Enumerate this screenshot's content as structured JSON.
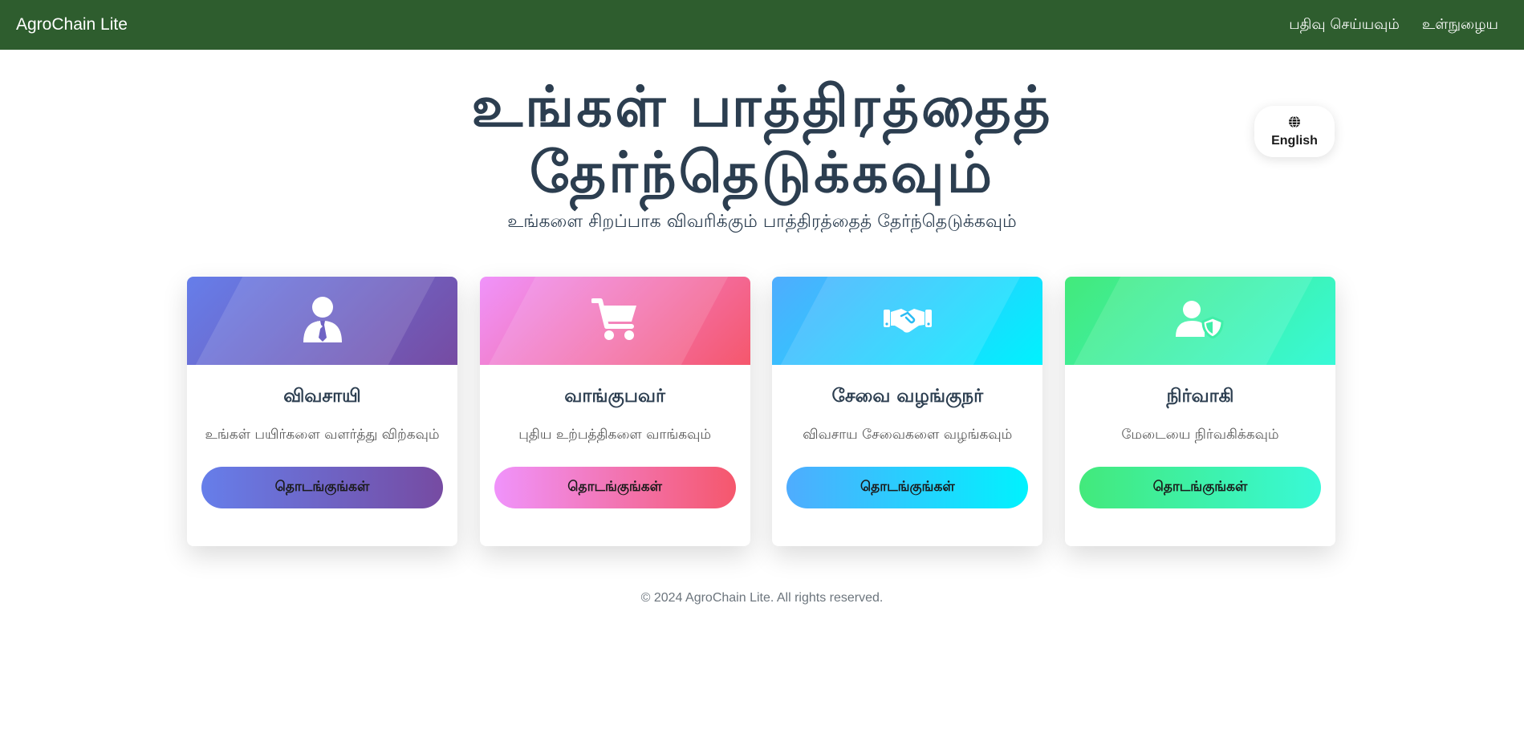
{
  "navbar": {
    "brand": "AgroChain Lite",
    "links": [
      "பதிவு செய்யவும்",
      "உள்நுழைய"
    ],
    "background": "#2e5d2e"
  },
  "language_toggle": {
    "icon": "globe-icon",
    "label": "English"
  },
  "hero": {
    "title_line1": "உங்கள் பாத்திரத்தைத்",
    "title_line2": "தேர்ந்தெடுக்கவும்",
    "subtitle": "உங்களை சிறப்பாக விவரிக்கும் பாத்திரத்தைத் தேர்ந்தெடுக்கவும்"
  },
  "roles": [
    {
      "icon": "farmer-icon",
      "title": "விவசாயி",
      "description": "உங்கள் பயிர்களை வளர்த்து விற்கவும்",
      "button": "தொடங்குங்கள்",
      "gradient": [
        "#667eea",
        "#764ba2"
      ]
    },
    {
      "icon": "cart-icon",
      "title": "வாங்குபவர்",
      "description": "புதிய உற்பத்திகளை வாங்கவும்",
      "button": "தொடங்குங்கள்",
      "gradient": [
        "#f093fb",
        "#f5576c"
      ]
    },
    {
      "icon": "handshake-icon",
      "title": "சேவை வழங்குநர்",
      "description": "விவசாய சேவைகளை வழங்கவும்",
      "button": "தொடங்குங்கள்",
      "gradient": [
        "#4facfe",
        "#00f2fe"
      ]
    },
    {
      "icon": "user-shield-icon",
      "title": "நிர்வாகி",
      "description": "மேடையை நிர்வகிக்கவும்",
      "button": "தொடங்குங்கள்",
      "gradient": [
        "#43e97b",
        "#38f9d7"
      ]
    }
  ],
  "footer": {
    "text": "© 2024 AgroChain Lite. All rights reserved."
  }
}
